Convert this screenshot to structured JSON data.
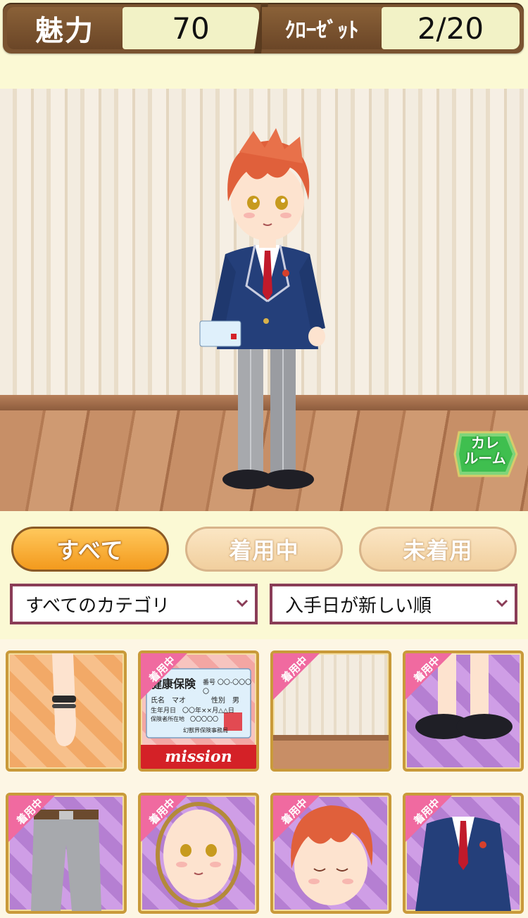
{
  "stats": {
    "charm_label": "魅力",
    "charm_value": "70",
    "closet_label": "ｸﾛｰｾﾞｯﾄ",
    "closet_value": "2/20"
  },
  "room": {
    "kare_room_label_line1": "カレ",
    "kare_room_label_line2": "ルーム",
    "kare_room_color": "#3fbf4f"
  },
  "tabs": {
    "all": "すべて",
    "wearing": "着用中",
    "unworn": "未着用"
  },
  "filters": {
    "category_value": "すべてのカテゴリ",
    "sort_value": "入手日が新しい順"
  },
  "items": {
    "badge_label": "着用中",
    "insurance_card_title": "健康保険",
    "insurance_card_line1": "番号 〇〇-〇〇〇〇",
    "insurance_card_name": "氏名　マオ",
    "insurance_card_gender": "性別　男",
    "insurance_card_birth": "生年月日　〇〇年××月△△日",
    "insurance_card_addr": "保険者所在地　〇〇〇〇〇",
    "insurance_card_issuer": "幻獣界保険事務局",
    "mission_label": "mission",
    "card_held_label": "健康保険"
  },
  "colors": {
    "accent_orange": "#f39a1d",
    "frame_gold": "#c99a3a",
    "select_border": "#8a3d57",
    "badge_pink": "#f06aa0"
  }
}
